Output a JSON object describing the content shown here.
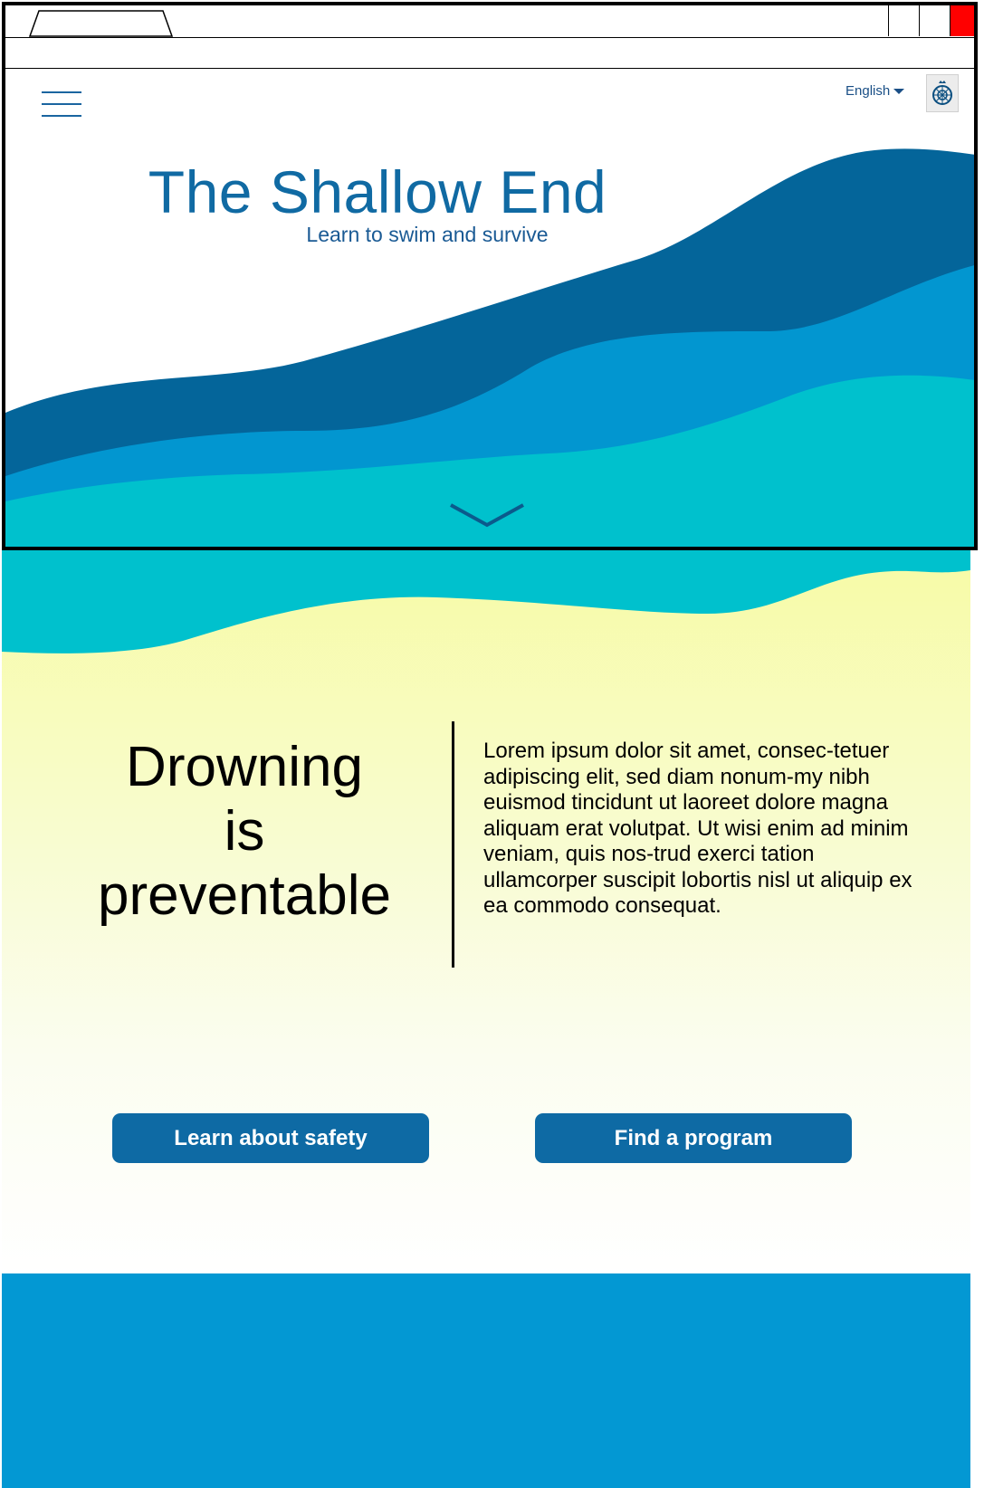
{
  "header": {
    "language_label": "English",
    "menu_icon": "hamburger-menu-icon",
    "crest_icon": "crest-emblem-icon"
  },
  "hero": {
    "title": "The Shallow End",
    "subtitle": "Learn to swim and survive",
    "scroll_icon": "chevron-down-icon"
  },
  "intro": {
    "headline_line1": "Drowning",
    "headline_line2": "is",
    "headline_line3": "preventable",
    "body": "Lorem ipsum dolor sit amet, consec-tetuer adipiscing elit, sed diam nonum-my nibh euismod tincidunt ut laoreet dolore magna aliquam erat volutpat. Ut wisi enim ad minim veniam, quis nos-trud exerci tation ullamcorper suscipit lobortis nisl ut aliquip ex ea commodo consequat."
  },
  "actions": {
    "learn_label": "Learn about safety",
    "find_label": "Find a program"
  },
  "colors": {
    "dark_blue": "#04659a",
    "mid_blue": "#0296d0",
    "turquoise": "#00c1cd",
    "sand": "#f7fba5",
    "button": "#0e6aa4",
    "close": "#ff0000"
  }
}
